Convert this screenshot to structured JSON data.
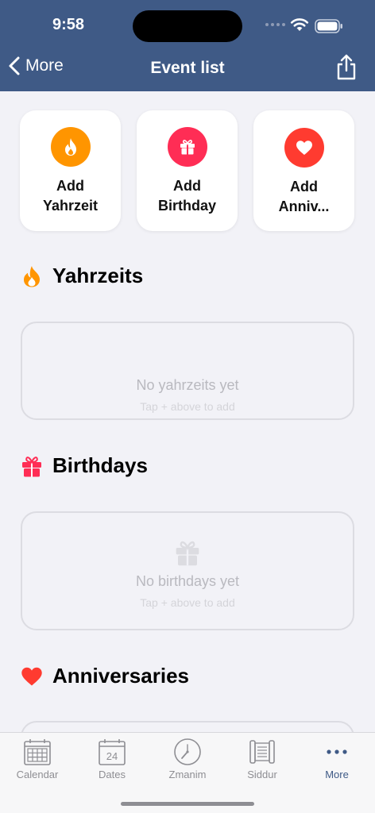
{
  "status": {
    "time": "9:58"
  },
  "nav": {
    "back_label": "More",
    "title": "Event list"
  },
  "add_cards": [
    {
      "line1": "Add",
      "line2": "Yahrzeit",
      "color": "#ff9500",
      "icon": "flame-icon"
    },
    {
      "line1": "Add",
      "line2": "Birthday",
      "color": "#ff2d55",
      "icon": "gift-icon"
    },
    {
      "line1": "Add",
      "line2": "Anniv...",
      "color": "#ff3b30",
      "icon": "heart-icon"
    }
  ],
  "sections": {
    "yahrzeits": {
      "title": "Yahrzeits",
      "empty_title": "No yahrzeits yet",
      "empty_hint": "Tap + above to add"
    },
    "birthdays": {
      "title": "Birthdays",
      "empty_title": "No birthdays yet",
      "empty_hint": "Tap + above to add"
    },
    "anniversaries": {
      "title": "Anniversaries"
    }
  },
  "tabs": [
    {
      "label": "Calendar",
      "icon": "calendar-icon"
    },
    {
      "label": "Dates",
      "icon": "dates-icon",
      "badge": "24"
    },
    {
      "label": "Zmanim",
      "icon": "clock-icon"
    },
    {
      "label": "Siddur",
      "icon": "scroll-icon"
    },
    {
      "label": "More",
      "icon": "more-icon",
      "active": true
    }
  ],
  "colors": {
    "nav": "#3f5a86",
    "background": "#f2f2f7",
    "active_tab": "#3f5a86"
  }
}
